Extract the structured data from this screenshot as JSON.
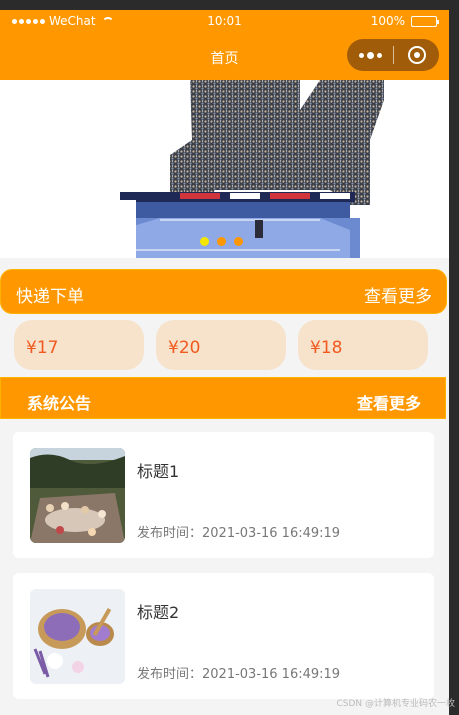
{
  "status_bar": {
    "carrier": "WeChat",
    "time": "10:01",
    "battery": "100%"
  },
  "nav": {
    "title": "首页"
  },
  "banner": {
    "indicator_count": 3,
    "active_index": 0,
    "colors": {
      "active": "#f5e600",
      "inactive": "#ff9800"
    }
  },
  "express": {
    "title": "快递下单",
    "more": "查看更多",
    "prices": [
      "¥17",
      "¥20",
      "¥18"
    ]
  },
  "notice": {
    "title": "系统公告",
    "more": "查看更多",
    "items": [
      {
        "title": "标题1",
        "time": "发布时间：2021-03-16 16:49:19",
        "image": "garden-party-photo"
      },
      {
        "title": "标题2",
        "time": "发布时间：2021-03-16 16:49:19",
        "image": "lavender-spa-photo"
      }
    ]
  },
  "watermark": "CSDN @计算机专业码农一枚",
  "colors": {
    "brand_orange": "#ff9800",
    "price_bg": "#f7e2cc",
    "price_text": "#f05a1e"
  }
}
